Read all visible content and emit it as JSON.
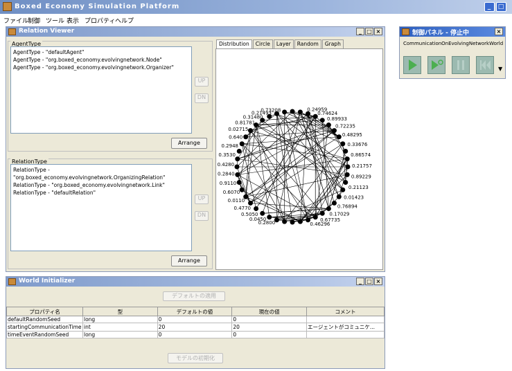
{
  "app": {
    "title": "Boxed Economy Simulation Platform",
    "menu": [
      "ファイル",
      "制御",
      "ツール",
      "表示",
      "プロパティ",
      "ヘルプ"
    ]
  },
  "relation_viewer": {
    "title": "Relation Viewer",
    "agent_group": "AgentType",
    "agent_items": [
      "AgentType - \"defaultAgent\"",
      "AgentType - \"org.boxed_economy.evolvingnetwork.Node\"",
      "AgentType - \"org.boxed_economy.evolvingnetwork.Organizer\""
    ],
    "relation_group": "RelationType",
    "relation_items": [
      "RelationType - \"org.boxed_economy.evolvingnetwork.OrganizingRelation\"",
      "RelationType - \"org.boxed_economy.evolvingnetwork.Link\"",
      "RelationType - \"defaultRelation\""
    ],
    "up_label": "UP",
    "dn_label": "DN",
    "arrange_label": "Arrange",
    "tabs": [
      "Distribution",
      "Circle",
      "Layer",
      "Random",
      "Graph"
    ],
    "right_labels": [
      "0.24959",
      "0.74624",
      "0.89933",
      "0.72235",
      "0.48295",
      "0.33676",
      "0.86574",
      "0.21757",
      "0.89229",
      "0.21123",
      "0.01423",
      "0.76894",
      "0.17029",
      "0.67735",
      "0.46296"
    ],
    "left_labels": [
      "0.73208",
      "0.21493",
      "0.31480",
      "0.81781",
      "0.02715",
      "0.640",
      "0.2948",
      "0.3530",
      "0.4280",
      "0.2840",
      "0.9110",
      "0.6070",
      "0.0110",
      "0.4770",
      "0.5050",
      "0.0450",
      "0.2800"
    ]
  },
  "control_panel": {
    "title": "制御パネル - 停止中",
    "model": "CommunicationOnEvolvingNetworkWorld"
  },
  "world_initializer": {
    "title": "World Initializer",
    "default_button": "デフォルトの適用",
    "headers": [
      "プロパティ名",
      "型",
      "デフォルトの値",
      "現在の値",
      "コメント"
    ],
    "rows": [
      [
        "defaultRandomSeed",
        "long",
        "0",
        "0",
        ""
      ],
      [
        "startingCommunicationTime",
        "int",
        "20",
        "20",
        "エージェントがコミュニケ..."
      ],
      [
        "timeEventRandomSeed",
        "long",
        "0",
        "0",
        ""
      ]
    ],
    "init_button": "モデルの初期化"
  }
}
